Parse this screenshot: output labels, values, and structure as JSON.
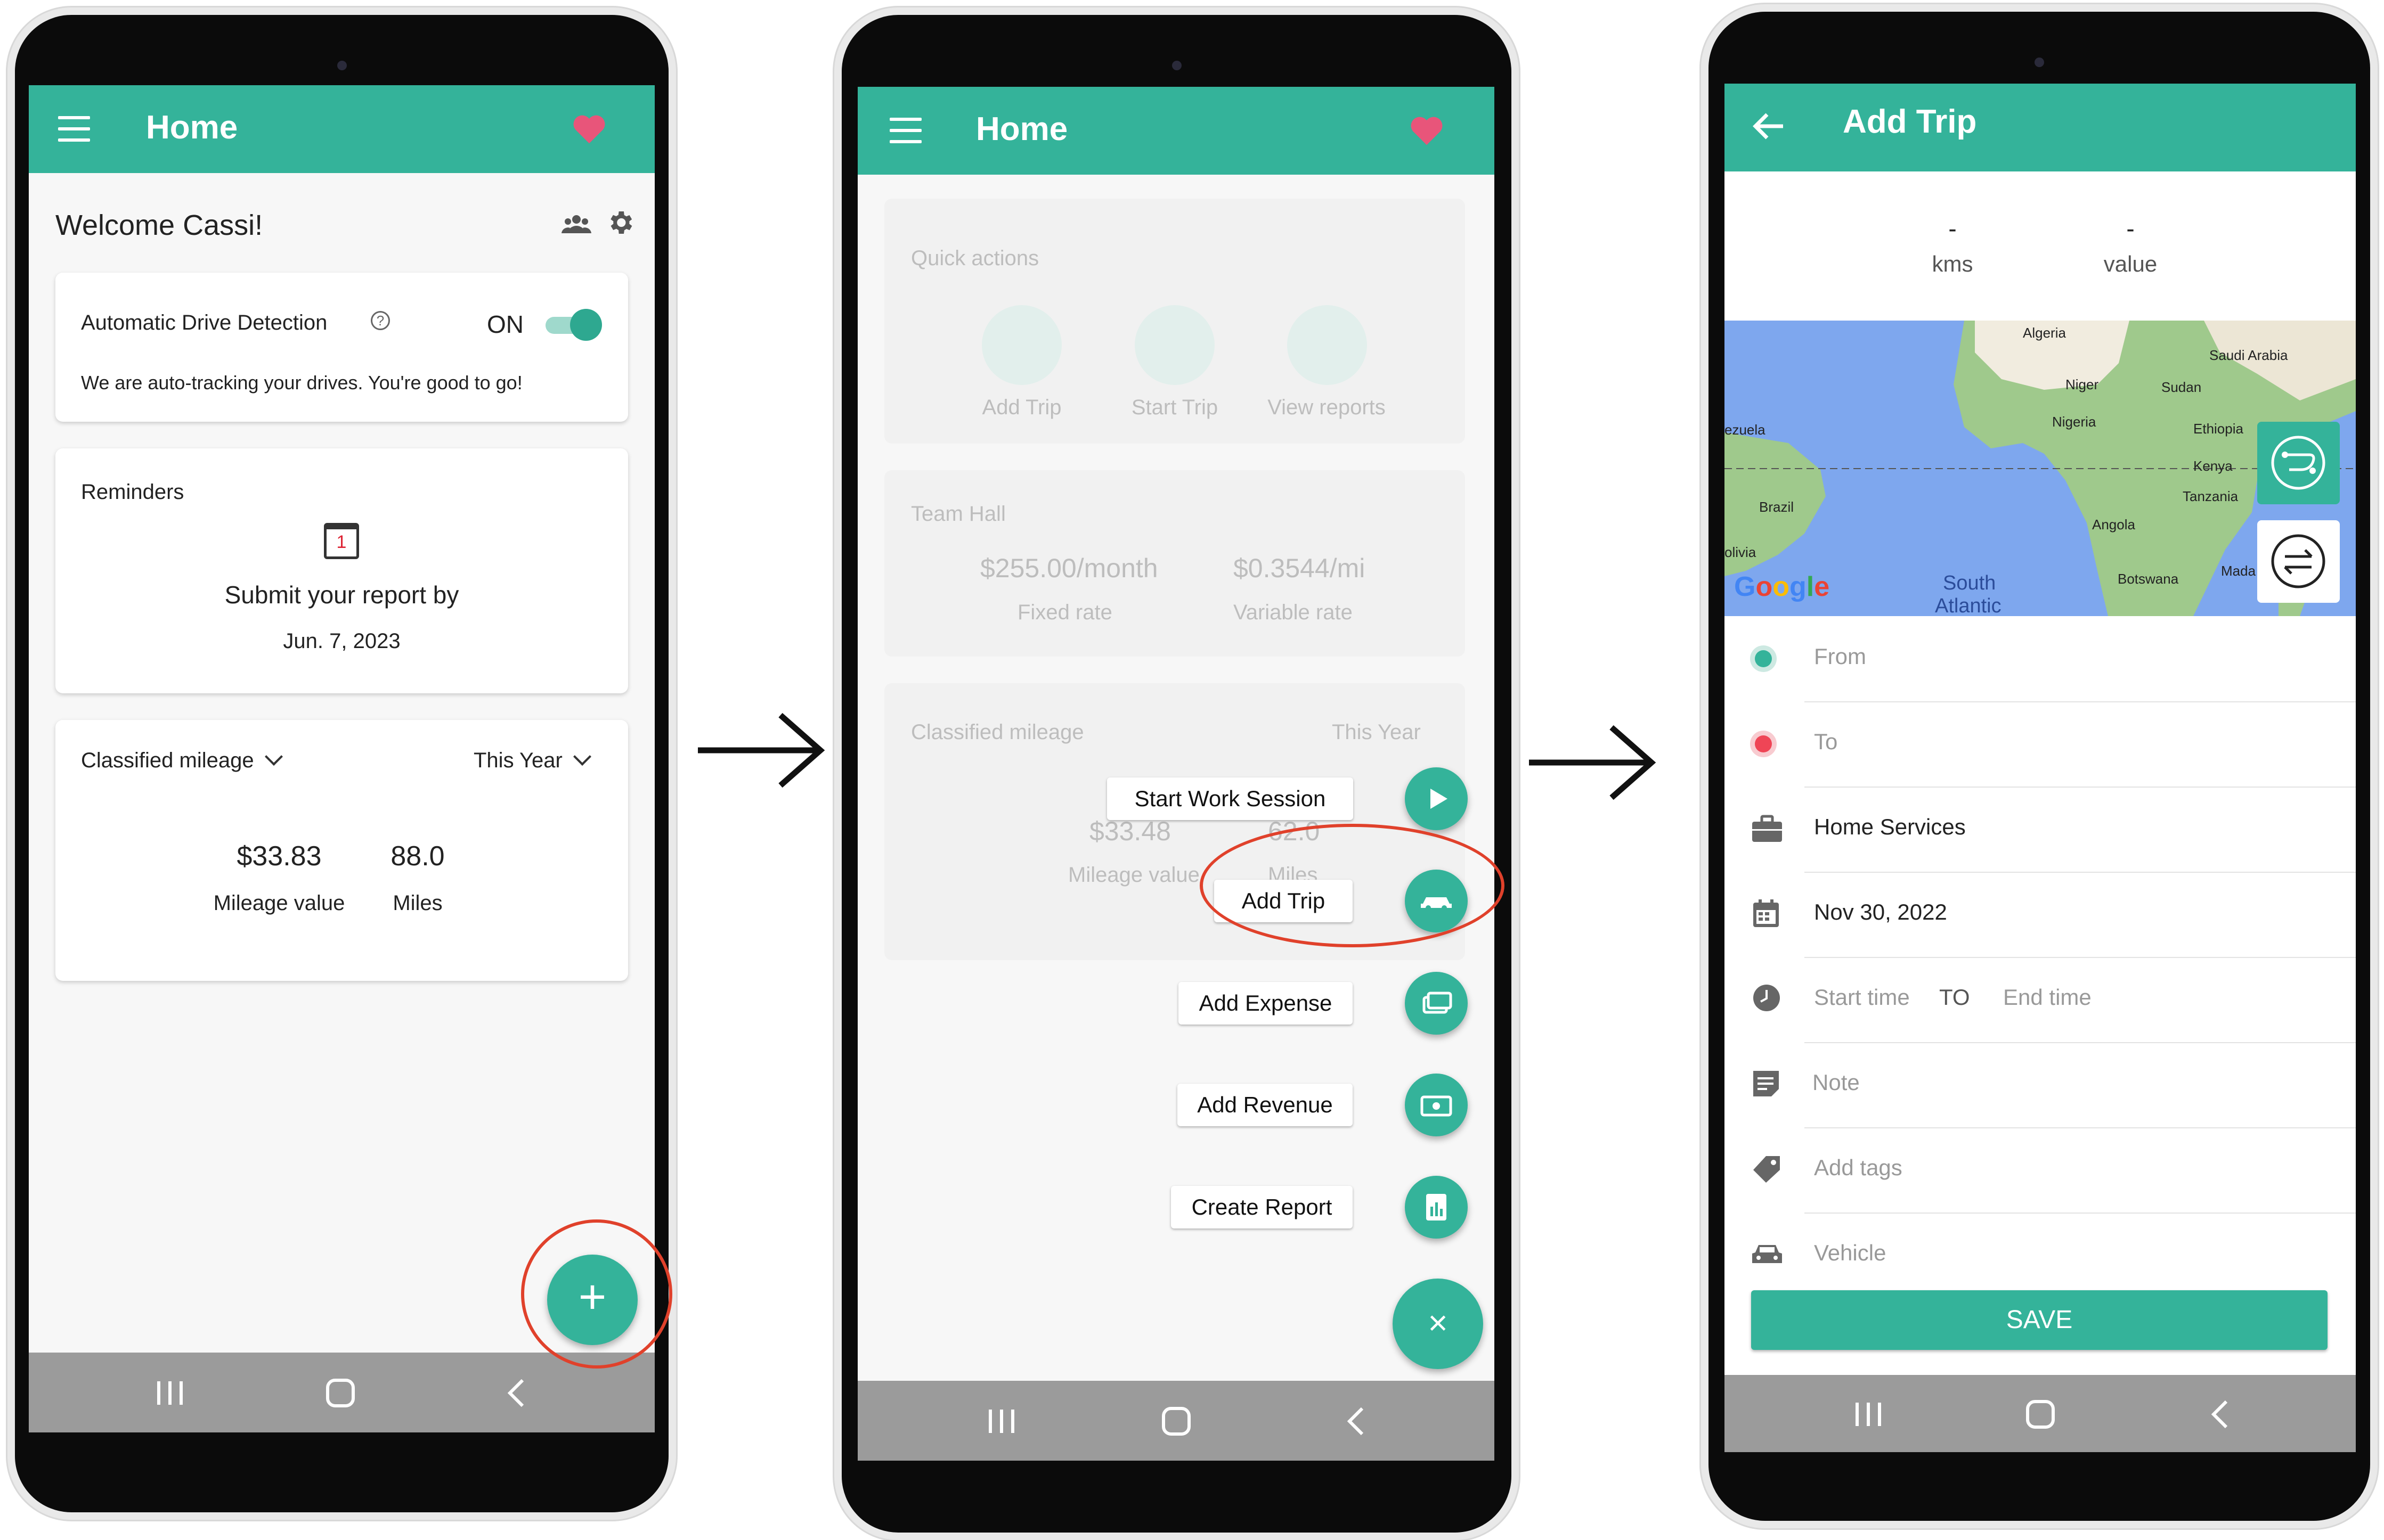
{
  "colors": {
    "accent": "#34b39a",
    "heart": "#e8557a",
    "red_ring": "#e0412b",
    "from_dot": "#34b39a",
    "to_dot": "#ef4556"
  },
  "screen1": {
    "title": "Home",
    "welcome": "Welcome Cassi!",
    "detection": {
      "label": "Automatic Drive Detection",
      "status": "ON",
      "message": "We are auto-tracking your drives. You're good to go!"
    },
    "reminders": {
      "title": "Reminders",
      "calendar_day": "1",
      "text": "Submit your report by",
      "date": "Jun. 7, 2023"
    },
    "mileage": {
      "title": "Classified mileage",
      "period": "This Year",
      "value": "$33.83",
      "value_label": "Mileage value",
      "miles": "88.0",
      "miles_label": "Miles"
    },
    "fab": "+"
  },
  "screen2": {
    "title": "Home",
    "bg": {
      "quick_actions": "Quick actions",
      "actions": [
        "Add Trip",
        "Start Trip",
        "View reports"
      ],
      "team": "Team Hall",
      "rate1": "$255.00/month",
      "rate1_label": "Fixed rate",
      "rate2": "$0.3544/mi",
      "rate2_label": "Variable rate",
      "mileage": "Classified mileage",
      "period": "This Year",
      "value": "$33.48",
      "value_label": "Mileage value",
      "miles": "62.0",
      "miles_label": "Miles"
    },
    "menu": [
      "Start Work Session",
      "Add Trip",
      "Add Expense",
      "Add Revenue",
      "Create Report"
    ],
    "close": "×"
  },
  "screen3": {
    "title": "Add Trip",
    "kms_value": "-",
    "kms_label": "kms",
    "value_value": "-",
    "value_label": "value",
    "map_labels": [
      "Algeria",
      "Saudi Arabia",
      "Niger",
      "Sudan",
      "Nigeria",
      "Ethiopia",
      "Kenya",
      "Tanzania",
      "Brazil",
      "Angola",
      "Botswana",
      "Mada",
      "South",
      "Atlantic",
      "ezuela",
      "olivia"
    ],
    "google": [
      "G",
      "o",
      "o",
      "g",
      "l",
      "e"
    ],
    "fields": {
      "from": "From",
      "to": "To",
      "category": "Home Services",
      "date": "Nov 30, 2022",
      "start": "Start time",
      "sep": "TO",
      "end": "End time",
      "note": "Note",
      "tags": "Add tags",
      "vehicle": "Vehicle"
    },
    "save": "SAVE"
  }
}
